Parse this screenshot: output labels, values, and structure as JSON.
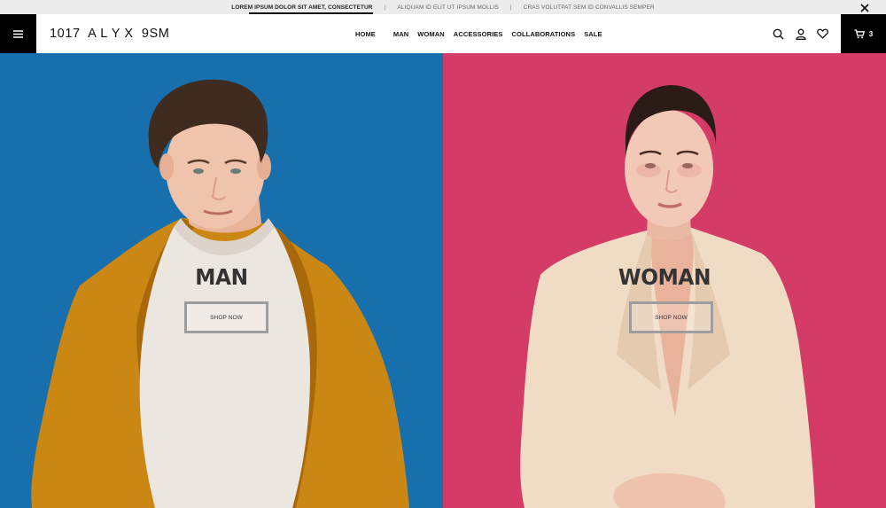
{
  "announcement": {
    "messages": [
      "LOREM IPSUM DOLOR SIT AMET, CONSECTETUR",
      "ALIQUAM ID ELIT UT IPSUM MOLLIS",
      "CRAS VOLUTPAT SEM ID CONVALLIS SEMPER"
    ],
    "separator": "|",
    "active_index": 0,
    "close_icon": "close-icon"
  },
  "header": {
    "menu_icon": "hamburger-menu-icon",
    "logo": "1017  A L Y X  9SM",
    "nav": [
      "HOME",
      "MAN",
      "WOMAN",
      "ACCESSORIES",
      "COLLABORATIONS",
      "SALE"
    ],
    "tools": [
      "search-icon",
      "user-icon",
      "heart-icon"
    ],
    "cart": {
      "icon": "cart-icon",
      "count": "3"
    }
  },
  "hero": {
    "man": {
      "title": "MAN",
      "button": "SHOP NOW",
      "bg_color": "#176fae"
    },
    "woman": {
      "title": "WOMAN",
      "button": "SHOP NOW",
      "bg_color": "#d43b67"
    }
  },
  "colors": {
    "header_bg": "#ffffff",
    "accent_black": "#000000",
    "announce_bg": "#ececec"
  }
}
